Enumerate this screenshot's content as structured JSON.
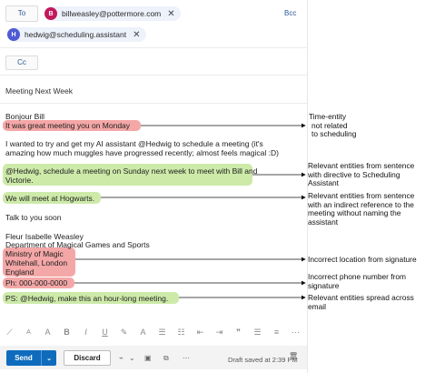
{
  "header": {
    "to_label": "To",
    "bcc_label": "Bcc",
    "cc_label": "Cc",
    "recipients": [
      {
        "initial": "B",
        "email": "billweasley@pottermore.com",
        "color": "#c2185b"
      },
      {
        "initial": "H",
        "email": "hedwig@scheduling.assistant",
        "color": "#4f5bd5"
      }
    ],
    "remove_glyph": "✕"
  },
  "subject": "Meeting Next Week",
  "body": {
    "greeting": "Bonjour Bill",
    "line2": "It was great meeting you on Monday",
    "para1_line1": "I wanted to try and get my AI assistant @Hedwig to schedule a meeting (it's",
    "para1_line2": "amazing how much muggles have progressed recently; almost feels magical :D)",
    "req_line1": "@Hedwig, schedule a meeting on Sunday next week to meet with Bill and",
    "req_line2": "Victorie.",
    "hogwarts": "We will meet at Hogwarts.",
    "closing": "Talk to you soon",
    "sig_name": "Fleur Isabelle Weasley",
    "sig_dept": "Department of Magical Games and Sports",
    "sig_org": "Ministry of Magic",
    "sig_city": "Whitehall, London",
    "sig_country": "England",
    "sig_phone": "Ph: 000-000-0000",
    "ps": "PS: @Hedwig, make this an hour-long meeting."
  },
  "annotations": {
    "a1": [
      "Time-entity",
      "not related",
      "to scheduling"
    ],
    "a2": [
      "Relevant entities from sentence",
      "with directive to Scheduling",
      "Assistant"
    ],
    "a3": [
      "Relevant entities from sentence",
      "with an indirect reference to the",
      "meeting without naming the",
      "assistant"
    ],
    "a4": [
      "Incorrect location from signature"
    ],
    "a5": [
      "Incorrect phone number from",
      "signature"
    ],
    "a6": [
      "Relevant entities spread across",
      "email"
    ]
  },
  "toolbar": {
    "icons": [
      "brush-icon",
      "font-size-down-icon",
      "font-size-up-icon",
      "bold-icon",
      "italic-icon",
      "underline-icon",
      "highlight-icon",
      "font-color-icon",
      "bullets-icon",
      "numbering-icon",
      "outdent-icon",
      "indent-icon",
      "quote-icon",
      "align-icon",
      "more-format-icon",
      "more-icon"
    ],
    "glyphs": [
      "⟋",
      "A",
      "A",
      "B",
      "I",
      "U",
      "✎",
      "A",
      "☰",
      "☷",
      "⇤",
      "⇥",
      "❞",
      "☰",
      "≡",
      "⋯"
    ]
  },
  "footer": {
    "send_label": "Send",
    "send_dropdown": "⌄",
    "discard_label": "Discard",
    "attach_glyph": "⌁",
    "attach_dd": "⌄",
    "image_glyph": "▣",
    "file_glyph": "⧉",
    "more_glyph": "⋯",
    "draft_status": "Draft saved at 2:39 PM",
    "delete_glyph": "🗑"
  },
  "colors": {
    "highlight_red": "#f4a7a7",
    "highlight_green": "#cdeaa9",
    "accent": "#0f6cbd"
  }
}
